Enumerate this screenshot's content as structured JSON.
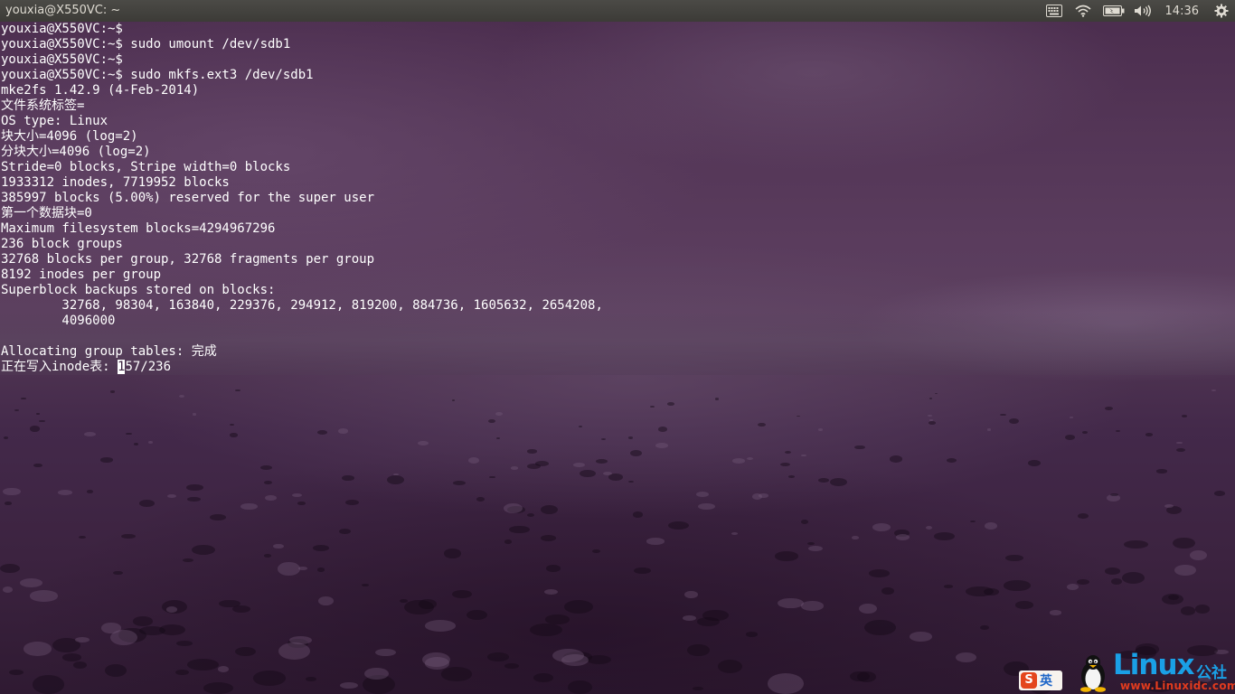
{
  "window": {
    "title": "youxia@X550VC: ~"
  },
  "tray": {
    "time": "14:36",
    "icons": [
      "keyboard-icon",
      "wifi-icon",
      "battery-icon",
      "volume-icon",
      "gear-icon"
    ]
  },
  "terminal": {
    "lines": [
      "youxia@X550VC:~$",
      "youxia@X550VC:~$ sudo umount /dev/sdb1",
      "youxia@X550VC:~$",
      "youxia@X550VC:~$ sudo mkfs.ext3 /dev/sdb1",
      "mke2fs 1.42.9 (4-Feb-2014)",
      "文件系统标签=",
      "OS type: Linux",
      "块大小=4096 (log=2)",
      "分块大小=4096 (log=2)",
      "Stride=0 blocks, Stripe width=0 blocks",
      "1933312 inodes, 7719952 blocks",
      "385997 blocks (5.00%) reserved for the super user",
      "第一个数据块=0",
      "Maximum filesystem blocks=4294967296",
      "236 block groups",
      "32768 blocks per group, 32768 fragments per group",
      "8192 inodes per group",
      "Superblock backups stored on blocks:",
      "        32768, 98304, 163840, 229376, 294912, 819200, 884736, 1605632, 2654208,",
      "        4096000",
      "",
      "Allocating group tables: 完成"
    ],
    "progress": {
      "prefix": "正在写入inode表: ",
      "cursor_char": "1",
      "suffix": "57/236"
    }
  },
  "watermark": {
    "ime_char": "S",
    "ime_label": "英",
    "brand": "Linux",
    "brand_suffix": "公社",
    "url": "www.Linuxidc.com"
  }
}
